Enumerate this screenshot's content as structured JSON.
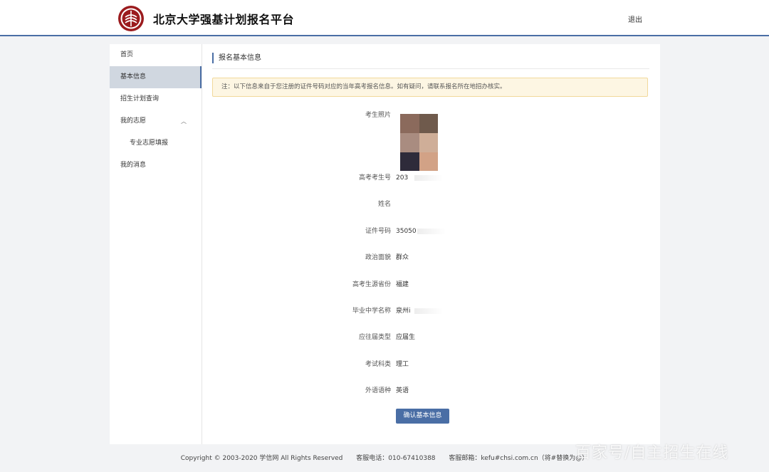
{
  "header": {
    "title": "北京大学强基计划报名平台",
    "logout": "退出"
  },
  "sidebar": {
    "items": [
      {
        "label": "首页"
      },
      {
        "label": "基本信息"
      },
      {
        "label": "招生计划查询"
      },
      {
        "label": "我的志愿"
      },
      {
        "label": "专业志愿填报"
      },
      {
        "label": "我的消息"
      }
    ]
  },
  "main": {
    "section_title": "报名基本信息",
    "notice": "注：以下信息来自于您注册的证件号码对应的当年高考报名信息。如有疑问，请联系报名所在地招办核实。",
    "photo_label": "考生照片",
    "fields": [
      {
        "label": "高考考生号",
        "value": "203"
      },
      {
        "label": "姓名",
        "value": ""
      },
      {
        "label": "证件号码",
        "value": "35050"
      },
      {
        "label": "政治面貌",
        "value": "群众"
      },
      {
        "label": "高考生源省份",
        "value": "福建"
      },
      {
        "label": "毕业中学名称",
        "value": "泉州i"
      },
      {
        "label": "应往届类型",
        "value": "应届生"
      },
      {
        "label": "考试科类",
        "value": "理工"
      },
      {
        "label": "外语语种",
        "value": "英语"
      }
    ],
    "confirm_button": "确认基本信息"
  },
  "footer": {
    "copyright": "Copyright © 2003-2020 学信网 All Rights Reserved",
    "phone": "客服电话：010-67410388",
    "email": "客服邮箱：kefu#chsi.com.cn（将#替换为@）"
  },
  "watermark": "百家号/自主招生在线",
  "colors": {
    "accent": "#4a6ea5",
    "active_bg": "#d0d7e0",
    "notice_bg": "#fdf6e3",
    "logo_red": "#9b1b1e"
  },
  "photo_tiles": [
    "#8b6a5c",
    "#6f5a4c",
    "#a98c80",
    "#cfae98",
    "#2e2b3a",
    "#d2a286"
  ]
}
